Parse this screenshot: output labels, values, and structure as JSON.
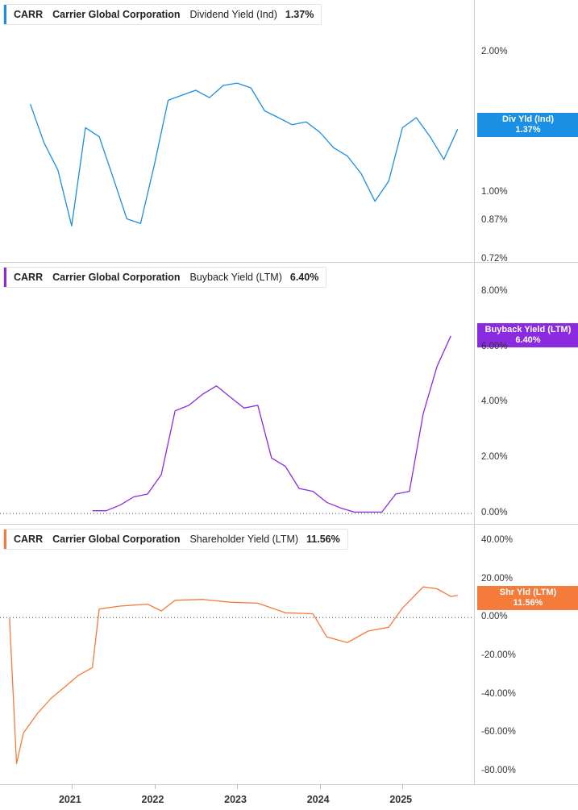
{
  "chart_data": [
    {
      "type": "line",
      "ticker": "CARR",
      "company": "Carrier Global Corporation",
      "metric": "Dividend Yield (Ind)",
      "current_value": "1.37%",
      "flag_label": "Div Yld (Ind)",
      "flag_value": "1.37%",
      "color": "#1a8fe3",
      "scale": "log",
      "ylim": [
        0.72,
        2.3
      ],
      "y_ticks": [
        "2.00%",
        "1.00%",
        "0.87%",
        "0.72%"
      ],
      "y_tick_values": [
        2.0,
        1.0,
        0.87,
        0.72
      ],
      "x": [
        "2020-07",
        "2020-09",
        "2020-11",
        "2021-01",
        "2021-03",
        "2021-05",
        "2021-07",
        "2021-09",
        "2021-11",
        "2022-01",
        "2022-03",
        "2022-05",
        "2022-07",
        "2022-09",
        "2022-11",
        "2023-01",
        "2023-03",
        "2023-05",
        "2023-07",
        "2023-09",
        "2023-11",
        "2024-01",
        "2024-03",
        "2024-05",
        "2024-07",
        "2024-09",
        "2024-11",
        "2025-01",
        "2025-03",
        "2025-05",
        "2025-07",
        "2025-09"
      ],
      "values": [
        1.55,
        1.28,
        1.12,
        0.85,
        1.38,
        1.32,
        1.08,
        0.88,
        0.86,
        1.15,
        1.58,
        1.62,
        1.66,
        1.6,
        1.7,
        1.72,
        1.68,
        1.5,
        1.45,
        1.4,
        1.42,
        1.35,
        1.25,
        1.2,
        1.1,
        0.96,
        1.06,
        1.38,
        1.45,
        1.32,
        1.18,
        1.37
      ]
    },
    {
      "type": "line",
      "ticker": "CARR",
      "company": "Carrier Global Corporation",
      "metric": "Buyback Yield (LTM)",
      "current_value": "6.40%",
      "flag_label": "Buyback Yield (LTM)",
      "flag_value": "6.40%",
      "color": "#8a2be2",
      "ylim": [
        -0.2,
        8.4
      ],
      "y_ticks": [
        "8.00%",
        "6.00%",
        "4.00%",
        "2.00%",
        "0.00%"
      ],
      "y_tick_values": [
        8,
        6,
        4,
        2,
        0
      ],
      "x": [
        "2021-04",
        "2021-06",
        "2021-08",
        "2021-10",
        "2021-12",
        "2022-02",
        "2022-04",
        "2022-06",
        "2022-08",
        "2022-10",
        "2022-12",
        "2023-02",
        "2023-04",
        "2023-06",
        "2023-08",
        "2023-10",
        "2023-12",
        "2024-02",
        "2024-04",
        "2024-06",
        "2024-08",
        "2024-10",
        "2024-12",
        "2025-02",
        "2025-04",
        "2025-06",
        "2025-08"
      ],
      "values": [
        0.1,
        0.1,
        0.3,
        0.6,
        0.7,
        1.4,
        3.7,
        3.9,
        4.3,
        4.6,
        4.2,
        3.8,
        3.9,
        2.0,
        1.7,
        0.9,
        0.8,
        0.4,
        0.2,
        0.05,
        0.05,
        0.05,
        0.7,
        0.8,
        3.6,
        5.3,
        6.4
      ]
    },
    {
      "type": "line",
      "ticker": "CARR",
      "company": "Carrier Global Corporation",
      "metric": "Shareholder Yield (LTM)",
      "current_value": "11.56%",
      "flag_label": "Shr Yld (LTM)",
      "flag_value": "11.56%",
      "color": "#f47b3a",
      "ylim": [
        -85,
        45
      ],
      "y_ticks": [
        "40.00%",
        "20.00%",
        "0.00%",
        "-20.00%",
        "-40.00%",
        "-60.00%",
        "-80.00%"
      ],
      "y_tick_values": [
        40,
        20,
        0,
        -20,
        -40,
        -60,
        -80
      ],
      "x": [
        "2020-04",
        "2020-04",
        "2020-05",
        "2020-06",
        "2020-08",
        "2020-10",
        "2020-12",
        "2021-02",
        "2021-04",
        "2021-05",
        "2021-08",
        "2021-12",
        "2022-02",
        "2022-04",
        "2022-08",
        "2022-12",
        "2023-04",
        "2023-08",
        "2023-12",
        "2024-02",
        "2024-05",
        "2024-08",
        "2024-11",
        "2025-01",
        "2025-04",
        "2025-06",
        "2025-08",
        "2025-09"
      ],
      "values": [
        0,
        -2,
        -76,
        -60,
        -50,
        -42,
        -36,
        -30,
        -26,
        4.5,
        6,
        7,
        3.5,
        9,
        9.5,
        8,
        7.5,
        2.5,
        2,
        -10,
        -13,
        -7,
        -5,
        5,
        16,
        15,
        11,
        11.56
      ]
    }
  ],
  "x_axis": {
    "labels": [
      "2021",
      "2022",
      "2023",
      "2024",
      "2025"
    ]
  }
}
